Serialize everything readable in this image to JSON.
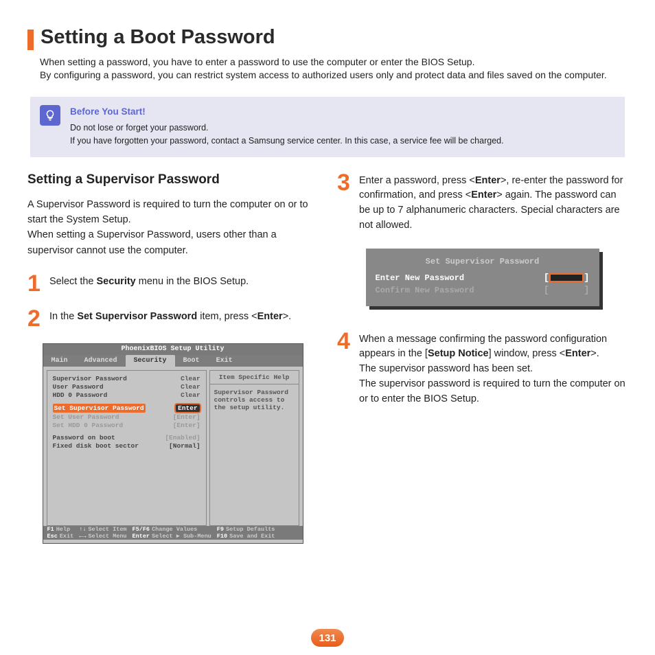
{
  "title": "Setting a Boot Password",
  "intro_p1": "When setting a password, you have to enter a password to use the computer or enter the BIOS Setup.",
  "intro_p2": "By configuring a password, you can restrict system access to authorized users only and protect data and files saved on the computer.",
  "callout": {
    "title": "Before You Start!",
    "line1": "Do not lose or forget your password.",
    "line2": "If you have forgotten your password, contact a Samsung service center. In this case, a service fee will be charged."
  },
  "left": {
    "subheading": "Setting a Supervisor Password",
    "body": "A Supervisor Password is required to turn the computer on or to start the System Setup.\nWhen setting a Supervisor Password, users other than a supervisor cannot use the computer.",
    "step1_pre": "Select the ",
    "step1_bold": "Security",
    "step1_post": " menu in the BIOS Setup.",
    "step2_pre": "In the ",
    "step2_bold": "Set Supervisor Password",
    "step2_mid": " item, press <",
    "step2_bold2": "Enter",
    "step2_post": ">."
  },
  "bios1": {
    "title": "PhoenixBIOS Setup Utility",
    "tabs": [
      "Main",
      "Advanced",
      "Security",
      "Boot",
      "Exit"
    ],
    "active_tab": 2,
    "rows": [
      {
        "label": "Supervisor Password",
        "value": "Clear"
      },
      {
        "label": "User Password",
        "value": "Clear"
      },
      {
        "label": "HDD 0 Password",
        "value": "Clear"
      }
    ],
    "hl_row": {
      "label": "Set Supervisor Password",
      "value": "Enter"
    },
    "dim_rows": [
      {
        "label": "Set User Password",
        "value": "[Enter]"
      },
      {
        "label": "Set HDD 0 Password",
        "value": "[Enter]"
      }
    ],
    "bottom_rows": [
      {
        "label": "Password on boot",
        "value": "[Enabled]",
        "dim": true
      },
      {
        "label": "Fixed disk boot sector",
        "value": "[Normal]"
      }
    ],
    "help_title": "Item Specific Help",
    "help_body": "Supervisor Password controls access to the setup utility.",
    "footer": [
      {
        "k": "F1",
        "l": "Help"
      },
      {
        "k": "↑↓",
        "l": "Select Item"
      },
      {
        "k": "F5/F6",
        "l": "Change Values"
      },
      {
        "k": "F9",
        "l": "Setup Defaults"
      },
      {
        "k": "Esc",
        "l": "Exit"
      },
      {
        "k": "←→",
        "l": "Select Menu"
      },
      {
        "k": "Enter",
        "l": "Select ▶ Sub-Menu"
      },
      {
        "k": "F10",
        "l": "Save and Exit"
      }
    ]
  },
  "right": {
    "step3_a": "Enter a password, press <",
    "step3_b": "Enter",
    "step3_c": ">, re-enter the password for confirmation, and press <",
    "step3_d": "Enter",
    "step3_e": "> again. The password can be up to 7 alphanumeric characters. Special characters are not allowed.",
    "step4_a": "When a message confirming the password configuration appears in the [",
    "step4_b": "Setup Notice",
    "step4_c": "] window, press <",
    "step4_d": "Enter",
    "step4_e": ">.",
    "step4_line2": "The supervisor password has been set.",
    "step4_line3": "The supervisor password is required to turn the computer on or to enter the BIOS Setup."
  },
  "bios2": {
    "title": "Set Supervisor Password",
    "row1": "Enter New Password",
    "row2": "Confirm New Password"
  },
  "page_number": "131",
  "nums": {
    "n1": "1",
    "n2": "2",
    "n3": "3",
    "n4": "4"
  }
}
